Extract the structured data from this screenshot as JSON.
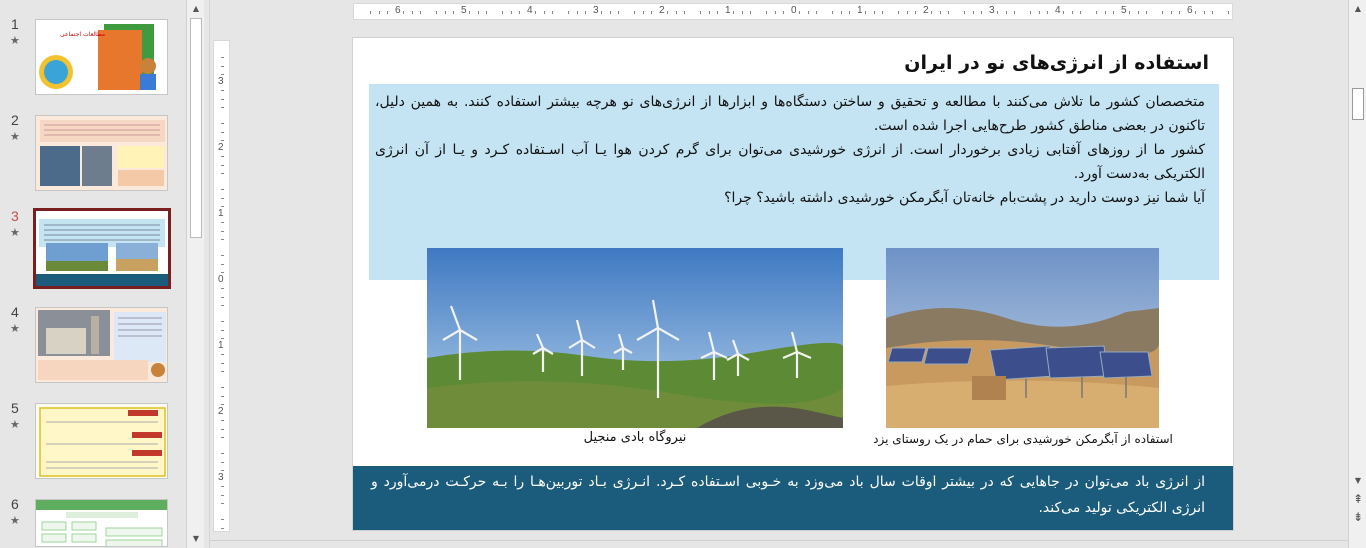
{
  "thumbnails": [
    {
      "number": "1",
      "star": "★",
      "active": false
    },
    {
      "number": "2",
      "star": "★",
      "active": false
    },
    {
      "number": "3",
      "star": "★",
      "active": true
    },
    {
      "number": "4",
      "star": "★",
      "active": false
    },
    {
      "number": "5",
      "star": "★",
      "active": false
    },
    {
      "number": "6",
      "star": "★",
      "active": false
    }
  ],
  "ruler": {
    "horizontal_labels": [
      "6",
      "5",
      "4",
      "3",
      "2",
      "1",
      "0",
      "1",
      "2",
      "3",
      "4",
      "5",
      "6"
    ],
    "vertical_labels": [
      "3",
      "2",
      "1",
      "0",
      "1",
      "2",
      "3"
    ]
  },
  "slide": {
    "title": "استفاده از انرژی‌های نو در ایران",
    "intro_paragraphs": [
      "متخصصان کشور ما تلاش می‌کنند با مطالعه و تحقیق و ساختن دستگاه‌ها و ابزارها از انرژی‌های نو هرچه بیشتر استفاده کنند. به همین دلیل، تاکنون در بعضی مناطق کشور طرح‌هایی اجرا شده است.",
      "کشور ما از روزهای آفتابی زیادی برخوردار است. از انرژی خورشیدی می‌توان برای گرم کردن هوا یـا آب اسـتفاده کـرد و یـا از آن انرژی الکتریکی به‌دست آورد.",
      "آیا شما نیز دوست دارید در پشت‌بام خانه‌تان آبگرمکن خورشیدی داشته باشید؟ چرا؟"
    ],
    "wind_caption": "نیروگاه بادی منجیل",
    "solar_caption": "استفاده از آبگرمکن خورشیدی برای حمام در یک روستای یزد",
    "bottom_text": "از انرژی باد می‌توان در جاهایی که در بیشتر اوقات سال باد می‌وزد به خـوبی اسـتفاده کـرد. انـرژی بـاد توربین‌هـا را بـه حرکـت درمی‌آورد و انرژی الکتریکی تولید می‌کند."
  },
  "colors": {
    "intro_box": "#c4e4f3",
    "bottom_box": "#1b5c7c",
    "active_thumb_border": "#7a1f1f",
    "active_number": "#c0504d"
  },
  "icons": {
    "scroll_up": "▲",
    "scroll_down": "▼",
    "prev_slide": "⇞",
    "next_slide": "⇟"
  }
}
